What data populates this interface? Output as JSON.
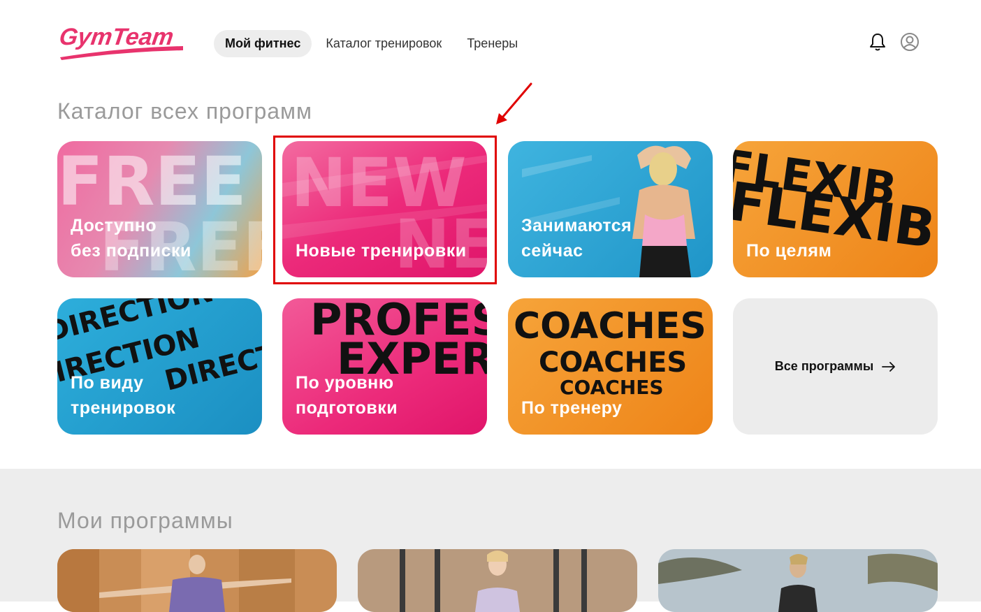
{
  "header": {
    "logo_text": "GymTeam",
    "nav": [
      {
        "label": "Мой фитнес",
        "active": true
      },
      {
        "label": "Каталог тренировок",
        "active": false
      },
      {
        "label": "Тренеры",
        "active": false
      }
    ],
    "icons": [
      "bell-icon",
      "user-icon"
    ]
  },
  "catalog": {
    "title": "Каталог всех программ",
    "cards": [
      {
        "label": "Доступно\nбез подписки",
        "bg_word": "FREE"
      },
      {
        "label": "Новые тренировки",
        "bg_word": "NEW"
      },
      {
        "label": "Занимаются\nсейчас"
      },
      {
        "label": "По целям",
        "bg_word": "FLEXIB"
      },
      {
        "label": "По виду\nтренировок",
        "bg_word": "DIRECTION"
      },
      {
        "label": "По уровню\nподготовки",
        "bg_word": "PROFES"
      },
      {
        "label": "По тренеру",
        "bg_word": "COACHES"
      }
    ],
    "all_programs": "Все программы"
  },
  "my_programs": {
    "title": "Мои программы"
  },
  "colors": {
    "pink": "#ec2a7a",
    "blue": "#2aa0cf",
    "orange": "#f08a1e",
    "highlight": "#e00000"
  }
}
